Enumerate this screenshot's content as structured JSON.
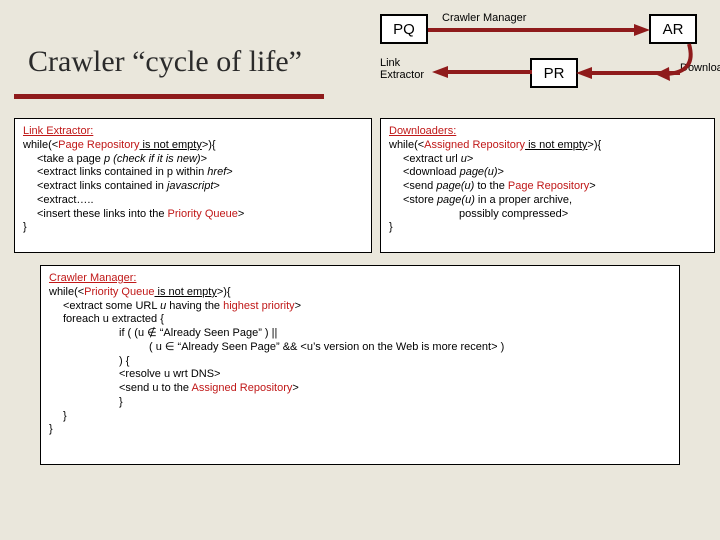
{
  "title": "Crawler “cycle of life”",
  "nodes": {
    "pq": "PQ",
    "ar": "AR",
    "pr": "PR"
  },
  "labels": {
    "crawler_manager": "Crawler Manager",
    "link_extractor": "Link Extractor",
    "link": "Link",
    "extractor": "Extractor",
    "downloaders": "Downloaders"
  },
  "le_box": {
    "heading": "Link Extractor:",
    "l1a": "while(<",
    "l1b": "Page Repository",
    "l1c": " is not empty",
    "l1d": ">){",
    "l2a": "<take a page ",
    "l2b": "p (check if it is new)",
    "l2c": ">",
    "l3a": "<extract links contained in p within ",
    "l3b": "href",
    "l3c": ">",
    "l4a": "<extract links contained in ",
    "l4b": "javascript",
    "l4c": ">",
    "l5": "<extract…..",
    "l6a": "<insert these links into the ",
    "l6b": "Priority Queue",
    "l6c": ">",
    "close": "}"
  },
  "dl_box": {
    "heading": "Downloaders:",
    "l1a": "while(<",
    "l1b": "Assigned Repository",
    "l1c": " is not empty",
    "l1d": ">){",
    "l2a": "<extract url ",
    "l2b": "u",
    "l2c": ">",
    "l3a": "<download ",
    "l3b": "page(u)",
    "l3c": ">",
    "l4a": "<send ",
    "l4b": "page(u)",
    "l4c": " to the ",
    "l4d": "Page Repository",
    "l4e": ">",
    "l5a": "<store ",
    "l5b": "page(u)",
    "l5c": " in a proper archive,",
    "l6": "possibly compressed>",
    "close": "}"
  },
  "cm_box": {
    "heading": "Crawler Manager:",
    "l1a": "while(<",
    "l1b": "Priority Queue",
    "l1c": " is not empty",
    "l1d": ">){",
    "l2a": "<extract some URL ",
    "l2b": "u",
    "l2c": " having the ",
    "l2d": "highest priority",
    "l2e": ">",
    "l3": "foreach u extracted {",
    "l4": "if ( (u ∉ “Already Seen Page” ) ||",
    "l5": "( u ∈ “Already Seen Page”  && <u’s version on the Web is more recent> )",
    "l6": ") {",
    "l7": "<resolve u wrt DNS>",
    "l8a": "<send u to the ",
    "l8b": "Assigned Repository",
    "l8c": ">",
    "l9": "}",
    "l10": "}",
    "close": "}"
  },
  "colors": {
    "accent": "#8f1b1b",
    "bg": "#eae7dc"
  }
}
